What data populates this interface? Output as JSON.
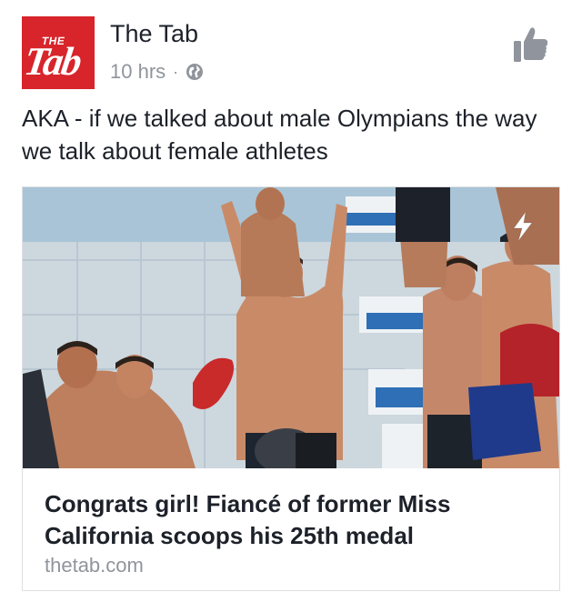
{
  "post": {
    "page_name": "The Tab",
    "avatar_logo_top": "THE",
    "avatar_logo_main": "Tab",
    "timestamp": "10 hrs",
    "separator": "·",
    "privacy_icon": "globe-icon",
    "like_icon": "thumbs-up-icon",
    "text": "AKA - if we talked about male Olympians the way we talk about female athletes"
  },
  "link": {
    "title": "Congrats girl! Fiancé of former Miss California scoops his 25th medal",
    "domain": "thetab.com",
    "instant_article_icon": "lightning-bolt-icon"
  },
  "colors": {
    "brand_red": "#d7252b",
    "text": "#1d2129",
    "secondary": "#90949c",
    "border": "#dddfe2"
  }
}
